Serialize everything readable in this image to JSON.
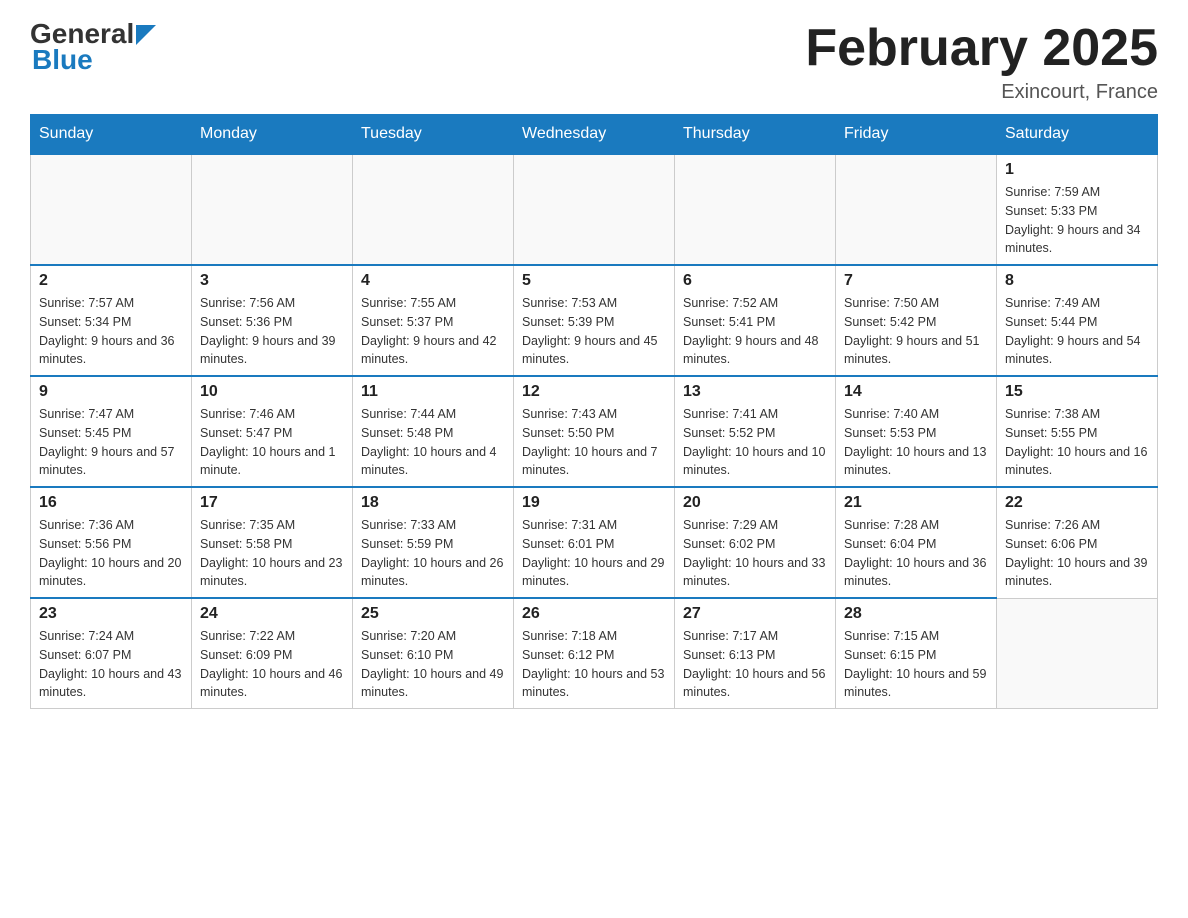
{
  "header": {
    "logo_general": "General",
    "logo_blue": "Blue",
    "month_title": "February 2025",
    "location": "Exincourt, France"
  },
  "days_of_week": [
    "Sunday",
    "Monday",
    "Tuesday",
    "Wednesday",
    "Thursday",
    "Friday",
    "Saturday"
  ],
  "weeks": [
    {
      "days": [
        {
          "num": "",
          "info": ""
        },
        {
          "num": "",
          "info": ""
        },
        {
          "num": "",
          "info": ""
        },
        {
          "num": "",
          "info": ""
        },
        {
          "num": "",
          "info": ""
        },
        {
          "num": "",
          "info": ""
        },
        {
          "num": "1",
          "info": "Sunrise: 7:59 AM\nSunset: 5:33 PM\nDaylight: 9 hours and 34 minutes."
        }
      ]
    },
    {
      "days": [
        {
          "num": "2",
          "info": "Sunrise: 7:57 AM\nSunset: 5:34 PM\nDaylight: 9 hours and 36 minutes."
        },
        {
          "num": "3",
          "info": "Sunrise: 7:56 AM\nSunset: 5:36 PM\nDaylight: 9 hours and 39 minutes."
        },
        {
          "num": "4",
          "info": "Sunrise: 7:55 AM\nSunset: 5:37 PM\nDaylight: 9 hours and 42 minutes."
        },
        {
          "num": "5",
          "info": "Sunrise: 7:53 AM\nSunset: 5:39 PM\nDaylight: 9 hours and 45 minutes."
        },
        {
          "num": "6",
          "info": "Sunrise: 7:52 AM\nSunset: 5:41 PM\nDaylight: 9 hours and 48 minutes."
        },
        {
          "num": "7",
          "info": "Sunrise: 7:50 AM\nSunset: 5:42 PM\nDaylight: 9 hours and 51 minutes."
        },
        {
          "num": "8",
          "info": "Sunrise: 7:49 AM\nSunset: 5:44 PM\nDaylight: 9 hours and 54 minutes."
        }
      ]
    },
    {
      "days": [
        {
          "num": "9",
          "info": "Sunrise: 7:47 AM\nSunset: 5:45 PM\nDaylight: 9 hours and 57 minutes."
        },
        {
          "num": "10",
          "info": "Sunrise: 7:46 AM\nSunset: 5:47 PM\nDaylight: 10 hours and 1 minute."
        },
        {
          "num": "11",
          "info": "Sunrise: 7:44 AM\nSunset: 5:48 PM\nDaylight: 10 hours and 4 minutes."
        },
        {
          "num": "12",
          "info": "Sunrise: 7:43 AM\nSunset: 5:50 PM\nDaylight: 10 hours and 7 minutes."
        },
        {
          "num": "13",
          "info": "Sunrise: 7:41 AM\nSunset: 5:52 PM\nDaylight: 10 hours and 10 minutes."
        },
        {
          "num": "14",
          "info": "Sunrise: 7:40 AM\nSunset: 5:53 PM\nDaylight: 10 hours and 13 minutes."
        },
        {
          "num": "15",
          "info": "Sunrise: 7:38 AM\nSunset: 5:55 PM\nDaylight: 10 hours and 16 minutes."
        }
      ]
    },
    {
      "days": [
        {
          "num": "16",
          "info": "Sunrise: 7:36 AM\nSunset: 5:56 PM\nDaylight: 10 hours and 20 minutes."
        },
        {
          "num": "17",
          "info": "Sunrise: 7:35 AM\nSunset: 5:58 PM\nDaylight: 10 hours and 23 minutes."
        },
        {
          "num": "18",
          "info": "Sunrise: 7:33 AM\nSunset: 5:59 PM\nDaylight: 10 hours and 26 minutes."
        },
        {
          "num": "19",
          "info": "Sunrise: 7:31 AM\nSunset: 6:01 PM\nDaylight: 10 hours and 29 minutes."
        },
        {
          "num": "20",
          "info": "Sunrise: 7:29 AM\nSunset: 6:02 PM\nDaylight: 10 hours and 33 minutes."
        },
        {
          "num": "21",
          "info": "Sunrise: 7:28 AM\nSunset: 6:04 PM\nDaylight: 10 hours and 36 minutes."
        },
        {
          "num": "22",
          "info": "Sunrise: 7:26 AM\nSunset: 6:06 PM\nDaylight: 10 hours and 39 minutes."
        }
      ]
    },
    {
      "days": [
        {
          "num": "23",
          "info": "Sunrise: 7:24 AM\nSunset: 6:07 PM\nDaylight: 10 hours and 43 minutes."
        },
        {
          "num": "24",
          "info": "Sunrise: 7:22 AM\nSunset: 6:09 PM\nDaylight: 10 hours and 46 minutes."
        },
        {
          "num": "25",
          "info": "Sunrise: 7:20 AM\nSunset: 6:10 PM\nDaylight: 10 hours and 49 minutes."
        },
        {
          "num": "26",
          "info": "Sunrise: 7:18 AM\nSunset: 6:12 PM\nDaylight: 10 hours and 53 minutes."
        },
        {
          "num": "27",
          "info": "Sunrise: 7:17 AM\nSunset: 6:13 PM\nDaylight: 10 hours and 56 minutes."
        },
        {
          "num": "28",
          "info": "Sunrise: 7:15 AM\nSunset: 6:15 PM\nDaylight: 10 hours and 59 minutes."
        },
        {
          "num": "",
          "info": ""
        }
      ]
    }
  ]
}
